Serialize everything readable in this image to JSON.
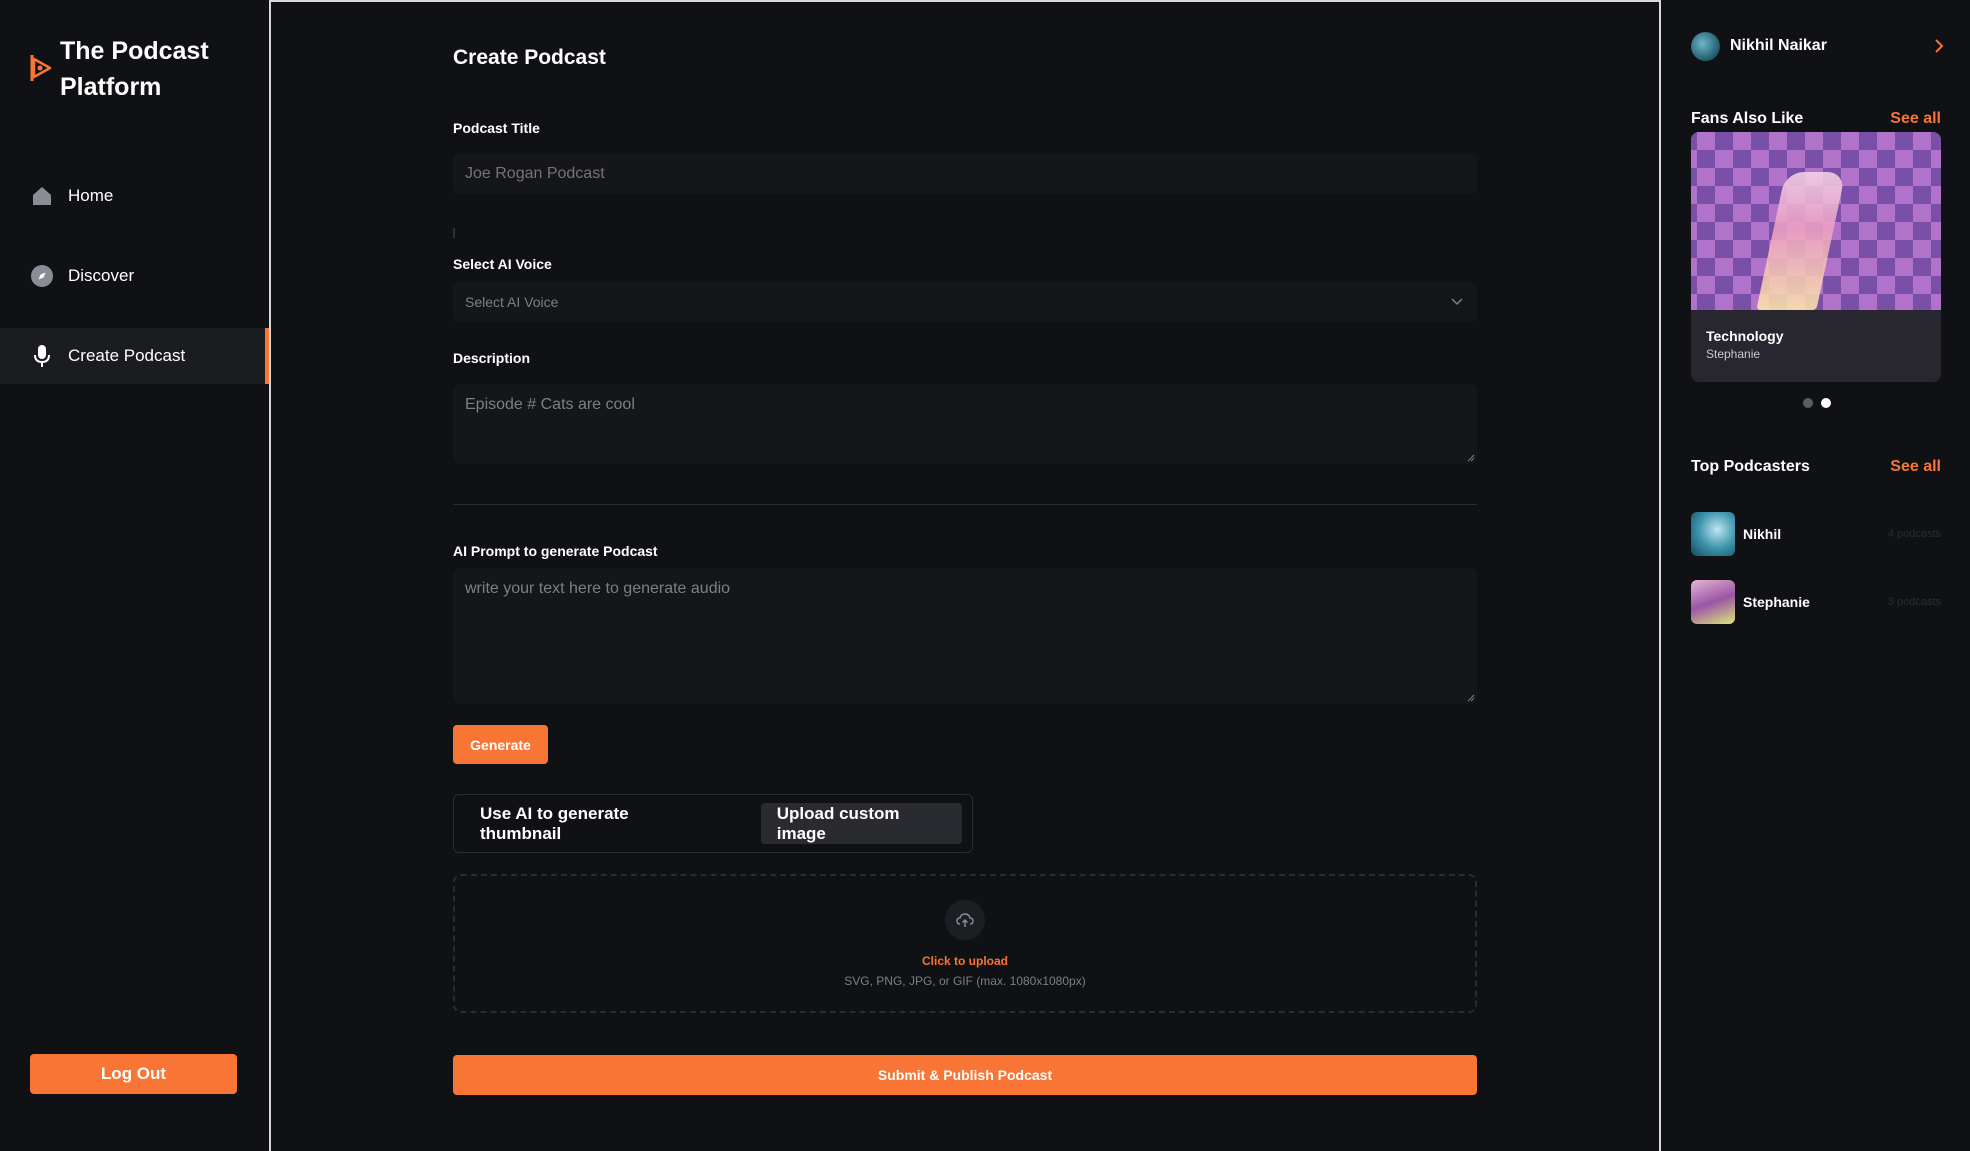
{
  "app": {
    "name": "The Podcast Platform",
    "accent_color": "#f97535",
    "logo_icon": "play-triangle-logo-icon"
  },
  "sidebar": {
    "items": [
      {
        "label": "Home",
        "icon": "home-icon",
        "active": false
      },
      {
        "label": "Discover",
        "icon": "compass-icon",
        "active": false
      },
      {
        "label": "Create Podcast",
        "icon": "microphone-icon",
        "active": true
      }
    ],
    "logout_label": "Log Out"
  },
  "main": {
    "page_title": "Create Podcast",
    "podcast_title": {
      "label": "Podcast Title",
      "placeholder": "Joe Rogan Podcast",
      "value": ""
    },
    "voice": {
      "label": "Select AI Voice",
      "placeholder": "Select AI Voice",
      "value": ""
    },
    "description": {
      "label": "Description",
      "placeholder": "Episode # Cats are cool",
      "value": ""
    },
    "prompt": {
      "label": "AI Prompt to generate Podcast",
      "placeholder": "write your text here to generate audio",
      "value": ""
    },
    "generate_label": "Generate",
    "thumbnail_toggle": {
      "options": [
        "Use AI to generate thumbnail",
        "Upload custom image"
      ],
      "selected": "Upload custom image"
    },
    "upload": {
      "cta": "Click to upload",
      "hint": "SVG, PNG, JPG, or GIF (max. 1080x1080px)",
      "icon": "upload-cloud-icon"
    },
    "submit_label": "Submit & Publish Podcast"
  },
  "right_sidebar": {
    "profile": {
      "name": "Nikhil Naikar",
      "icon": "chevron-right-icon"
    },
    "fans_also_like": {
      "heading": "Fans Also Like",
      "see_all": "See all",
      "card": {
        "title": "Technology",
        "author": "Stephanie"
      },
      "carousel": {
        "count": 2,
        "active_index": 1
      }
    },
    "top_podcasters": {
      "heading": "Top Podcasters",
      "see_all": "See all",
      "items": [
        {
          "name": "Nikhil",
          "count": "4 podcasts"
        },
        {
          "name": "Stephanie",
          "count": "3 podcasts"
        }
      ]
    }
  }
}
